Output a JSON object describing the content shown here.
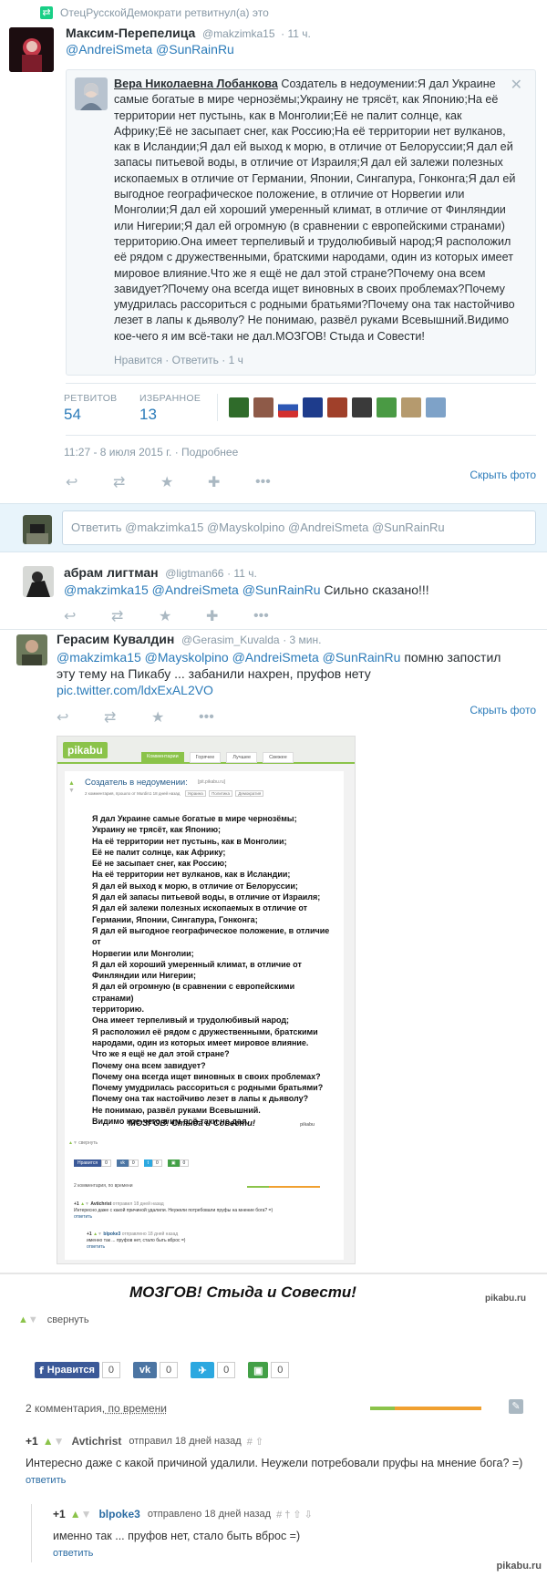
{
  "retweet_notice": "ОтецРусскойДемократи ретвитнул(а) это",
  "tweet1": {
    "name": "Максим-Перепелица",
    "handle": "@makzimka15",
    "time": "· 11 ч.",
    "mentions": "@AndreiSmeta @SunRainRu",
    "quote": {
      "name": "Вера Николаевна Лобанкова",
      "text": "Создатель в недоумении:Я дал Украине самые богатые в мире чернозёмы;Украину не трясёт, как Японию;На её территории нет пустынь, как в Монголии;Её не палит солнце, как Африку;Её не засыпает снег, как Россию;На её территории нет вулканов, как в Исландии;Я дал ей выход к морю, в отличие от Белоруссии;Я дал ей запасы питьевой воды, в отличие от Израиля;Я дал ей залежи полезных ископаемых в отличие от Германии, Японии, Сингапура, Гонконга;Я дал ей выгодное географическое положение, в отличие от Норвегии или Монголии;Я дал ей хороший умеренный климат, в отличие от Финляндии или Нигерии;Я дал ей огромную (в сравнении с европейскими странами) территорию.Она имеет терпеливый и трудолюбивый народ;Я расположил её рядом с дружественными, братскими народами, один из которых имеет мировое влияние.Что же я ещё не дал этой стране?Почему она всем завидует?Почему она всегда ищет виновных в своих проблемах?Почему умудрилась рассориться с родными братьями?Почему она так настойчиво лезет в лапы к дьяволу? Не понимаю, развёл руками Всевышний.Видимо кое-чего я им всё-таки не дал.МОЗГОВ! Стыда и Совести!",
      "like": "Нравится",
      "reply": "Ответить",
      "time": "· 1 ч"
    },
    "retweets_label": "РЕТВИТОВ",
    "retweets": "54",
    "favs_label": "ИЗБРАННОЕ",
    "favs": "13",
    "date": "11:27 - 8 июля 2015 г.",
    "details": "· Подробнее",
    "hide_photo": "Скрыть фото"
  },
  "reply_box": {
    "placeholder": "Ответить @makzimka15 @Mayskolpino @AndreiSmeta @SunRainRu"
  },
  "tweet2": {
    "name": "абрам лигтман",
    "handle": "@ligtman66",
    "time": "· 11 ч.",
    "mentions": "@makzimka15 @AndreiSmeta @SunRainRu",
    "text": " Сильно сказано!!!"
  },
  "tweet3": {
    "name": "Герасим Кувалдин",
    "handle": "@Gerasim_Kuvalda",
    "time": "· 3 мин.",
    "mentions": "@makzimka15 @Mayskolpino @AndreiSmeta @SunRainRu",
    "text_a": " помню запостил",
    "text_b": "эту тему на Пикабу ... забанили нахрен, пруфов нету",
    "link": "pic.twitter.com/ldxExAL2VO",
    "hide_photo": "Скрыть фото"
  },
  "pikabu_small": {
    "logo": "pikabu",
    "tabs": [
      "Комментарии",
      "Горячее",
      "Лучшее",
      "Свежее"
    ],
    "title": "Создатель в недоумении:",
    "domain": "[pit.pikabu.ru]",
    "meta": "2 комментария, прошло от Murdin1 18 дней назад",
    "tags": [
      "Украина",
      "Политика",
      "Демократия"
    ],
    "lines": [
      "Я дал Украине самые богатые в мире чернозёмы;",
      "Украину не трясёт, как Японию;",
      "На её территории нет пустынь, как в Монголии;",
      "Её не палит солнце, как Африку;",
      "Её не засыпает снег, как Россию;",
      "На её территории нет вулканов, как в Исландии;",
      "Я дал ей выход к морю, в отличие от Белоруссии;",
      "Я дал ей запасы питьевой воды, в отличие от Израиля;",
      "Я дал ей залежи полезных ископаемых в отличие от",
      "Германии, Японии, Сингапура, Гонконга;",
      "Я дал ей выгодное географическое положение, в отличие от",
      "Норвегии или Монголии;",
      "Я дал ей хороший умеренный климат, в отличие от",
      "Финляндии или Нигерии;",
      "Я дал ей огромную (в сравнении с европейскими странами)",
      "территорию.",
      "Она имеет терпеливый и трудолюбивый народ;",
      "Я расположил её рядом с дружественными, братскими",
      "народами, один из которых имеет мировое влияние.",
      "Что же я ещё не дал этой стране?",
      "Почему она всем завидует?",
      "Почему она всегда ищет виновных в своих проблемах?",
      "Почему умудрилась рассориться с родными братьями?",
      "Почему она так настойчиво лезет в лапы к дьяволу?",
      "Не понимаю, развёл руками Всевышний.",
      "Видимо кое-чего я им всё-таки не дал."
    ],
    "slogan": "МОЗГОВ! Стыда и Совести!",
    "watermark": "pikabu",
    "collapse": "свернуть",
    "like": "Нравится",
    "counts": [
      "0",
      "0",
      "0",
      "0"
    ],
    "comments_count": "2 комментария, по времени",
    "c1_user": "Avtichrist",
    "c1_meta": "отправил 18 дней назад",
    "c1_text": "Интересно даже с какой причиной удалили. Неужели потребовали пруфы на мнение бога? =)",
    "c1_reply": "ответить",
    "c2_user": "blpoke3",
    "c2_meta": "отправлено 18 дней назад",
    "c2_text": "именно так ... пруфов нет, стало быть вброс =)",
    "c2_reply": "ответить"
  },
  "pikabu_big": {
    "slogan": "МОЗГОВ! Стыда и Совести!",
    "watermark": "pikabu.ru",
    "collapse": "свернуть",
    "like": "Нравится",
    "counts": [
      "0",
      "0",
      "0",
      "0"
    ],
    "comments_label": "2 комментария,",
    "comments_sort": " по времени",
    "c1_score": "+1",
    "c1_user": "Avtichrist",
    "c1_meta": "отправил 18 дней назад",
    "c1_text": "Интересно даже с какой причиной удалили. Неужели потребовали пруфы на мнение бога? =)",
    "c1_reply": "ответить",
    "c2_score": "+1",
    "c2_user": "blpoke3",
    "c2_meta": "отправлено 18 дней назад",
    "c2_text": "именно так  ... пруфов нет, стало быть вброс =)",
    "c2_reply": "ответить"
  },
  "footer_watermark": "pikabu.ru",
  "colors": {
    "link": "#2b7bb9",
    "muted": "#8899a6",
    "pikabu_green": "#8bc34a",
    "fb": "#3b5998",
    "vk": "#4c75a3",
    "tw": "#2ca8e0",
    "save": "#43a047"
  }
}
